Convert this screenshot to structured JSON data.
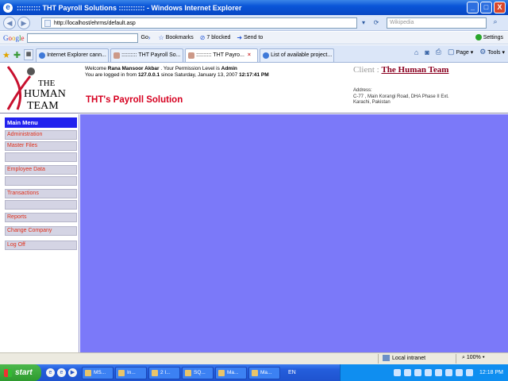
{
  "window": {
    "title": ":::::::::: THT Payroll Solutions ::::::::::: - Windows Internet Explorer",
    "minimize_icon": "_",
    "maximize_icon": "□",
    "close_icon": "X"
  },
  "address_bar": {
    "url": "http://localhost/ehrms/default.asp",
    "search_placeholder": "Wikipedia"
  },
  "google_toolbar": {
    "logo": [
      "G",
      "o",
      "o",
      "g",
      "l",
      "e"
    ],
    "go_label": "Go",
    "bookmarks_label": "Bookmarks",
    "blocked_label": "7 blocked",
    "send_to_label": "Send to",
    "settings_label": "Settings"
  },
  "tabs": [
    {
      "label": "Internet Explorer cann..."
    },
    {
      "label": ":::::::::: THT Payroll So..."
    },
    {
      "label": ":::::::::: THT Payro..."
    },
    {
      "label": "List of available project..."
    }
  ],
  "command_bar": {
    "page_label": "Page",
    "tools_label": "Tools"
  },
  "header": {
    "logo_line1": "THE",
    "logo_line2": "HUMAN",
    "logo_line3": "TEAM",
    "welcome_prefix": "Welcome",
    "user_name": "Rana Mansoor Akbar",
    "permission_text": ". Your Permission Level is",
    "permission_level": "Admin",
    "login_prefix": "You are logged in from",
    "login_ip": "127.0.0.1",
    "login_since": "since Saturday, January 13, 2007",
    "login_time": "12:17:41 PM",
    "app_title": "THT's Payroll Solution",
    "client_label": "Client :",
    "client_name": "The Human Team",
    "address_label": "Address:",
    "address_line1": "C-77 , Main Korangi Road, DHA Phase II Ext.",
    "address_line2": "Karachi, Pakistan"
  },
  "sidebar": {
    "title": "Main Menu",
    "items": [
      {
        "label": "Administration"
      },
      {
        "label": "Master Files"
      },
      {
        "label": ""
      },
      {
        "label": "Employee Data"
      },
      {
        "label": ""
      },
      {
        "label": "Transactions"
      },
      {
        "label": ""
      },
      {
        "label": "Reports"
      },
      {
        "label": "Change Company"
      },
      {
        "label": "Log Off"
      }
    ]
  },
  "status_bar": {
    "zone": "Local intranet",
    "zoom": "100%"
  },
  "taskbar": {
    "start_label": "start",
    "tasks": [
      {
        "label": "MS..."
      },
      {
        "label": "In..."
      },
      {
        "label": "2 I..."
      },
      {
        "label": "SQ..."
      },
      {
        "label": "Ma..."
      },
      {
        "label": "Ma..."
      }
    ],
    "language": "EN",
    "clock": "12:18 PM"
  },
  "colors": {
    "content_background": "#7b79f9",
    "menu_header": "#2222ee",
    "menu_link": "#e0301a",
    "title_red": "#d60020"
  }
}
